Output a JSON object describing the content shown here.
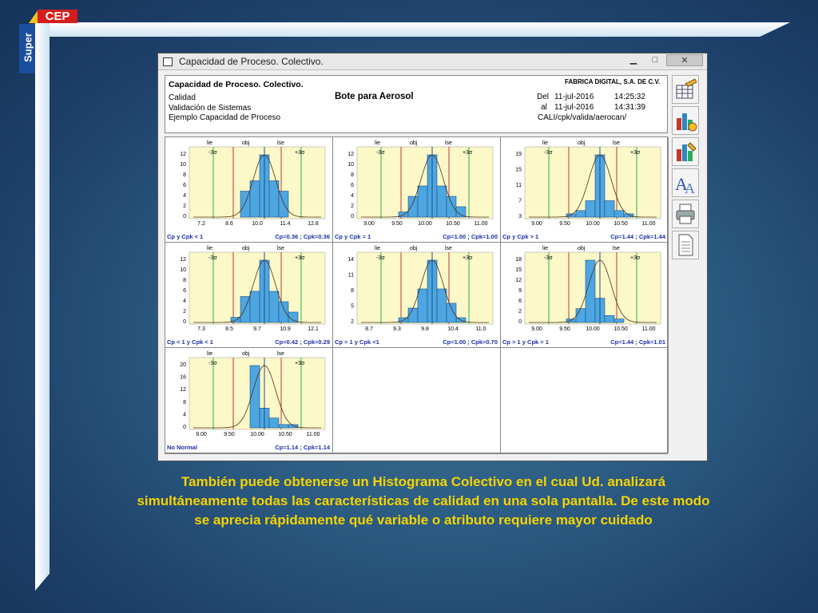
{
  "logo": {
    "cep": "CEP",
    "super": "Super"
  },
  "window": {
    "title": "Capacidad de Proceso. Colectivo.",
    "buttons": {
      "minimize": "▁",
      "maximize": "□",
      "close": "✕"
    }
  },
  "report": {
    "heading": "Capacidad de Proceso. Colectivo.",
    "line1": "Calidad",
    "line2": "Validación de Sistemas",
    "line3": "Ejemplo Capacidad de Proceso",
    "product": "Bote para Aerosol",
    "company": "FABRICA DIGITAL, S.A. DE C.V.",
    "from_label": "Del",
    "from_date": "11-jul-2016",
    "from_time": "14:25:32",
    "to_label": "al",
    "to_date": "11-jul-2016",
    "to_time": "14:31:39",
    "path": "CALI/cpk/valida/aerocan/"
  },
  "toolbar": {
    "icons": [
      "table-hand-icon",
      "bar-chart-gear-icon",
      "bar-chart-pencil-icon",
      "font-icon",
      "printer-icon",
      "document-icon"
    ]
  },
  "charts": [
    {
      "yticks": [
        "12",
        "10",
        "8",
        "6",
        "4",
        "2",
        "0"
      ],
      "xticks": [
        "7.2",
        "8.6",
        "10.0",
        "11.4",
        "12.8"
      ],
      "bars": [
        0,
        5,
        7,
        12,
        7,
        5,
        0
      ],
      "foot_left": "Cp y Cpk < 1",
      "foot_right": "Cp=0.36 ; Cpk=0.36"
    },
    {
      "yticks": [
        "12",
        "10",
        "8",
        "6",
        "4",
        "2",
        "0"
      ],
      "xticks": [
        "9.00",
        "9.50",
        "10.00",
        "10.50",
        "11.00"
      ],
      "bars": [
        1,
        4,
        6,
        12,
        6,
        4,
        2
      ],
      "foot_left": "Cp y Cpk = 1",
      "foot_right": "Cp=1.00 ; Cpk=1.00"
    },
    {
      "yticks": [
        "19",
        "15",
        "11",
        "7",
        "3"
      ],
      "xticks": [
        "9.00",
        "9.50",
        "10.00",
        "10.50",
        "11.00"
      ],
      "bars": [
        1,
        2,
        5,
        19,
        5,
        2,
        1
      ],
      "foot_left": "Cp y Cpk > 1",
      "foot_right": "Cp=1.44 ; Cpk=1.44"
    },
    {
      "yticks": [
        "12",
        "10",
        "8",
        "6",
        "4",
        "2",
        "0"
      ],
      "xticks": [
        "7.3",
        "8.5",
        "9.7",
        "10.9",
        "12.1"
      ],
      "bars": [
        1,
        5,
        6,
        12,
        6,
        4,
        2
      ],
      "foot_left": "Cp < 1 y Cpk < 1",
      "foot_right": "Cp=0.42 ; Cpk=0.29"
    },
    {
      "yticks": [
        "14",
        "11",
        "8",
        "5",
        "2"
      ],
      "xticks": [
        "8.7",
        "9.3",
        "9.8",
        "10.4",
        "11.0"
      ],
      "bars": [
        1,
        3,
        7,
        13,
        7,
        4,
        1
      ],
      "foot_left": "Cp = 1 y Cpk <1",
      "foot_right": "Cp=1.00 ; Cpk=0.70"
    },
    {
      "yticks": [
        "18",
        "15",
        "12",
        "9",
        "6",
        "2",
        "0"
      ],
      "xticks": [
        "9.00",
        "9.50",
        "10.00",
        "10.50",
        "11.00"
      ],
      "bars": [
        1,
        4,
        18,
        7,
        2,
        1,
        0
      ],
      "foot_left": "Cp > 1 y Cpk = 1",
      "foot_right": "Cp=1.44 ; Cpk=1.01"
    },
    {
      "yticks": [
        "20",
        "16",
        "12",
        "8",
        "4",
        "0"
      ],
      "xticks": [
        "9.00",
        "9.50",
        "10.00",
        "10.50",
        "11.00"
      ],
      "bars": [
        0,
        0,
        19,
        6,
        3,
        1,
        1
      ],
      "foot_left": "No Normal",
      "foot_right": "Cp=1.14 ; Cpk=1.14"
    }
  ],
  "chart_labels": {
    "lie": "lie",
    "obj": "obj",
    "lse": "lse",
    "minus3": "-3σ",
    "plus3": "+3σ"
  },
  "caption": "También puede obtenerse un Histograma Colectivo en el cual Ud. analizará simultáneamente todas las características de calidad en una sola pantalla. De este modo se aprecia rápidamente qué variable o atributo requiere mayor cuidado"
}
